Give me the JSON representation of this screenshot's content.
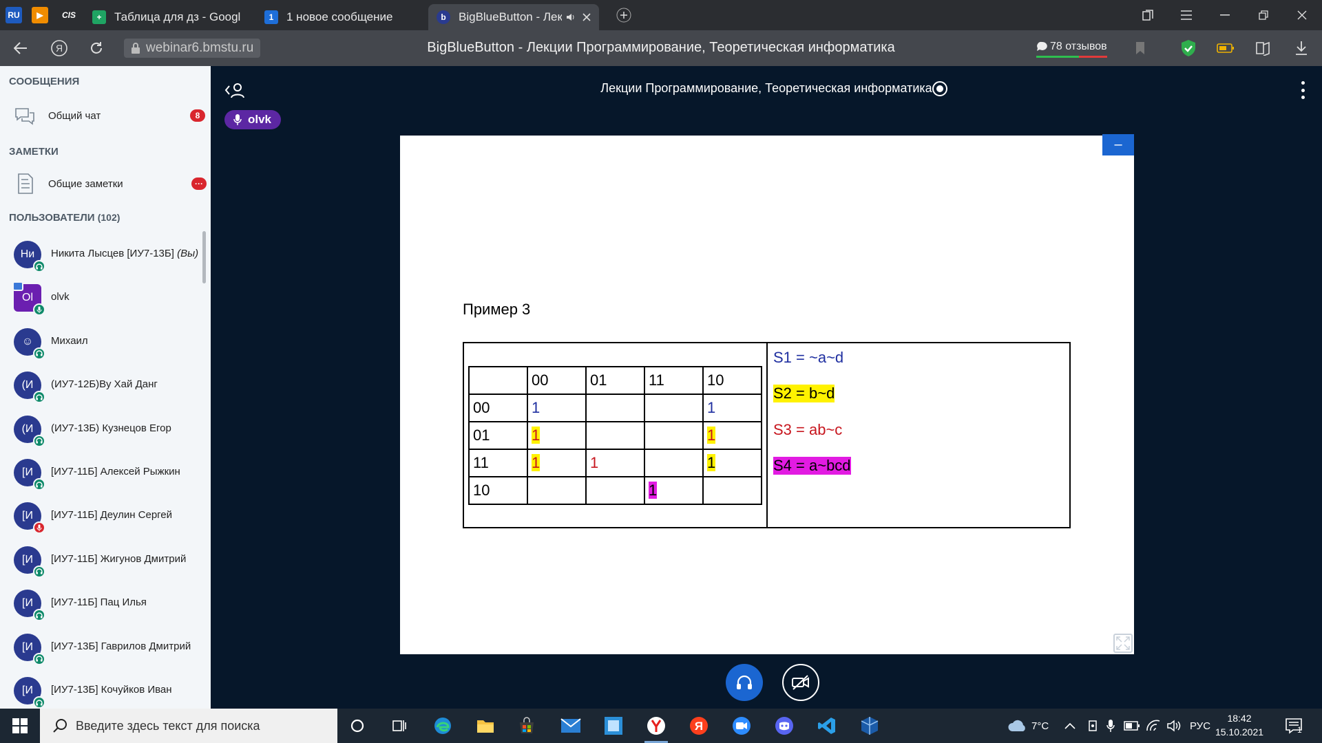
{
  "browser": {
    "tabs": [
      {
        "label": "Таблица для дз - Google Т"
      },
      {
        "label": "1 новое сообщение"
      },
      {
        "label": "BigBlueButton - Лекц"
      }
    ],
    "pinned": [
      "RU",
      "▶",
      "CIS"
    ],
    "tab_count_badge": "1",
    "url": "webinar6.bmstu.ru",
    "page_title": "BigBlueButton - Лекции Программирование, Теоретическая информатика",
    "reviews": "78 отзывов"
  },
  "sidebar": {
    "messages_heading": "СООБЩЕНИЯ",
    "public_chat": {
      "label": "Общий чат",
      "badge": "8"
    },
    "notes_heading": "ЗАМЕТКИ",
    "shared_notes": {
      "label": "Общие заметки",
      "badge": "···"
    },
    "users_heading": "ПОЛЬЗОВАТЕЛИ",
    "users_count": "(102)",
    "users": [
      {
        "initials": "Ни",
        "name": "Никита Лысцев [ИУ7-13Б]",
        "suffix": "(Вы)",
        "status": "listen"
      },
      {
        "initials": "Ol",
        "name": "olvk",
        "suffix": "",
        "status": "mic"
      },
      {
        "initials": "☺",
        "name": "Михаил",
        "suffix": "",
        "status": "listen"
      },
      {
        "initials": "(И",
        "name": "(ИУ7-12Б)Ву Хай Данг",
        "suffix": "",
        "status": "listen"
      },
      {
        "initials": "(И",
        "name": "(ИУ7-13Б) Кузнецов Егор",
        "suffix": "",
        "status": "listen"
      },
      {
        "initials": "[И",
        "name": "[ИУ7-11Б] Алексей Рыжкин",
        "suffix": "",
        "status": "listen"
      },
      {
        "initials": "[И",
        "name": "[ИУ7-11Б] Деулин Сергей",
        "suffix": "",
        "status": "mute"
      },
      {
        "initials": "[И",
        "name": "[ИУ7-11Б] Жигунов Дмитрий",
        "suffix": "",
        "status": "listen"
      },
      {
        "initials": "[И",
        "name": "[ИУ7-11Б] Пац Илья",
        "suffix": "",
        "status": "listen"
      },
      {
        "initials": "[И",
        "name": "[ИУ7-13Б] Гаврилов Дмитрий",
        "suffix": "",
        "status": "listen"
      },
      {
        "initials": "[И",
        "name": "[ИУ7-13Б] Кочуйков Иван",
        "suffix": "",
        "status": "listen"
      }
    ]
  },
  "meeting": {
    "title": "Лекции Программирование, Теоретическая информатика",
    "talker": "olvk"
  },
  "slide": {
    "heading": "Пример 3",
    "kmap": {
      "col_headers": [
        "00",
        "01",
        "11",
        "10"
      ],
      "rows": [
        {
          "label": "00",
          "cells": [
            "1",
            "",
            "",
            "1"
          ]
        },
        {
          "label": "01",
          "cells": [
            "1",
            "",
            "",
            "1"
          ]
        },
        {
          "label": "11",
          "cells": [
            "1",
            "1",
            "",
            "1"
          ]
        },
        {
          "label": "10",
          "cells": [
            "",
            "",
            "1",
            ""
          ]
        }
      ]
    },
    "equations": [
      "S1 = ~a~d",
      "S2 = b~d",
      "S3 = ab~c",
      "S4 = a~bcd"
    ],
    "colors": {
      "blue": "#1f2fa0",
      "red": "#c7161e",
      "yellow": "#fff200",
      "magenta": "#e21be2"
    }
  },
  "taskbar": {
    "search_placeholder": "Введите здесь текст для поиска",
    "weather": "7°C",
    "language": "РУС",
    "time": "18:42",
    "date": "15.10.2021",
    "notifications": "1"
  }
}
